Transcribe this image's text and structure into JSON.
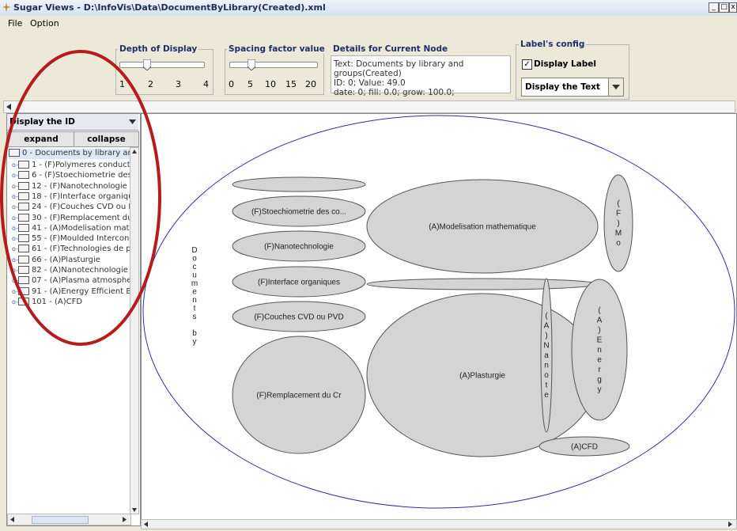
{
  "window": {
    "title": "Sugar Views - D:\\InfoVis\\Data\\DocumentByLibrary(Created).xml",
    "controls": [
      "_",
      "□",
      "x"
    ]
  },
  "menu": {
    "items": [
      "File",
      "Option"
    ]
  },
  "depth": {
    "label": "Depth of Display",
    "ticks": [
      "1",
      "2",
      "3",
      "4"
    ],
    "value": 2
  },
  "spacing": {
    "label": "Spacing factor value",
    "ticks": [
      "0",
      "5",
      "10",
      "15",
      "20"
    ],
    "value": 4
  },
  "details": {
    "label": "Details for Current Node",
    "lines": [
      "Text: Documents by library and groups(Created)",
      "ID: 0; Value: 49.0",
      "date: 0; fill: 0.0; grow: 100.0;"
    ]
  },
  "labels_config": {
    "label": "Label's config",
    "display_label_text": "Display Label",
    "display_label_checked": true,
    "combo_value": "Display the Text"
  },
  "left_panel": {
    "combo_value": "Display the ID",
    "expand_label": "expand",
    "collapse_label": "collapse"
  },
  "tree": {
    "root": "0 - Documents by library and g",
    "items": [
      "1 - (F)Polymeres conducte",
      "6 - (F)Stoechiometrie des",
      "12 - (F)Nanotechnologie",
      "18 - (F)Interface organique",
      "24 - (F)Couches CVD ou P",
      "30 - (F)Remplacement du",
      "41 - (A)Modelisation mathe",
      "55 - (F)Moulded Intercone",
      "61 - (F)Technologies de p",
      "66 - (A)Plasturgie",
      "82 - (A)Nanotechnologie c",
      "07 - (A)Plasma atmosphe",
      "91 - (A)Energy Efficient Bu",
      "101 - (A)CFD"
    ]
  },
  "canvas": {
    "root_vertical_label": "Documents by",
    "nodes": [
      "",
      "(F)Stoechiometrie des co...",
      "(F)Nanotechnologie",
      "(F)Interface organiques",
      "(F)Couches CVD ou PVD",
      "(F)Remplacement du Cr",
      "(A)Modelisation mathematique",
      "",
      "(A)Plasturgie",
      "(A)Nanote",
      "(A)Energy",
      "(F)Mo",
      "(A)CFD"
    ]
  },
  "colors": {
    "node_fill": "#d4d4d4",
    "outer_ellipse": "#2d2db0",
    "annotation_circle": "#b71c1c"
  }
}
